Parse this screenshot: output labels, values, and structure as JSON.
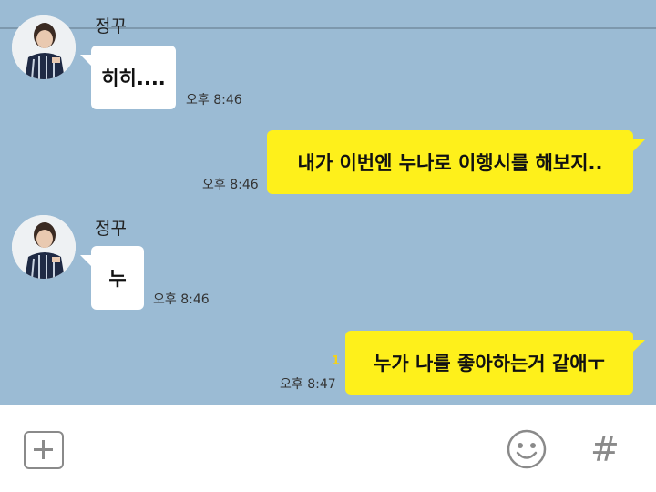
{
  "messages": [
    {
      "sender": "정꾸",
      "text": "히히....",
      "time": "오후 8:46",
      "direction": "in"
    },
    {
      "text": "내가 이번엔 누나로 이행시를 해보지..",
      "time": "오후 8:46",
      "direction": "out"
    },
    {
      "sender": "정꾸",
      "text": "누",
      "time": "오후 8:46",
      "direction": "in"
    },
    {
      "text": "누가 나를 좋아하는거 같애ㅜ",
      "time": "오후 8:47",
      "direction": "out",
      "unread": "1"
    }
  ],
  "colors": {
    "chat_background": "#9bbbd4",
    "incoming_bubble": "#ffffff",
    "outgoing_bubble": "#fef01b",
    "unread_count": "#f3d219",
    "icon_gray": "#8a8a8a"
  },
  "input_bar": {
    "attach_icon": "plus-icon",
    "emoticon_icon": "smiley-icon",
    "hash_icon": "hash-icon",
    "hash_label": "#"
  }
}
